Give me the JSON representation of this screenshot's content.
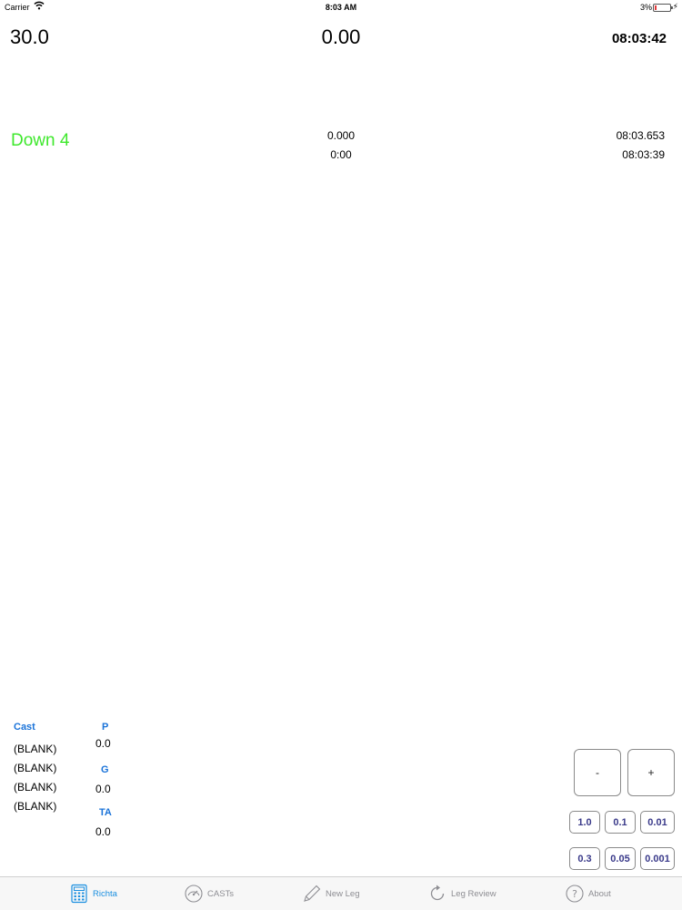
{
  "status_bar": {
    "carrier": "Carrier",
    "time": "8:03 AM",
    "battery_pct": "3%",
    "icons": [
      "wifi-icon",
      "battery-icon",
      "charging-bolt-icon"
    ]
  },
  "readout": {
    "left_value": "30.0",
    "center_value": "0.00",
    "right_time": "08:03:42",
    "status_text": "Down 4",
    "center_line1": "0.000",
    "center_line2": "0:00",
    "right_line1": "08:03.653",
    "right_line2": "08:03:39"
  },
  "info": {
    "cast_label": "Cast",
    "casts": [
      "(BLANK)",
      "(BLANK)",
      "(BLANK)",
      "(BLANK)"
    ],
    "p_label": "P",
    "p_value": "0.0",
    "g_label": "G",
    "g_value": "0.0",
    "ta_label": "TA",
    "ta_value": "0.0"
  },
  "controls": {
    "minus": "-",
    "plus": "+",
    "increments_row1": [
      "1.0",
      "0.1",
      "0.01"
    ],
    "increments_row2": [
      "0.3",
      "0.05",
      "0.001"
    ]
  },
  "tabs": [
    {
      "label": "Richta",
      "icon": "calculator-icon",
      "active": true
    },
    {
      "label": "CASTs",
      "icon": "speedometer-icon",
      "active": false
    },
    {
      "label": "New Leg",
      "icon": "pencil-icon",
      "active": false
    },
    {
      "label": "Leg Review",
      "icon": "refresh-icon",
      "active": false
    },
    {
      "label": "About",
      "icon": "question-icon",
      "active": false
    }
  ],
  "colors": {
    "accent": "#1a8fe0",
    "status_green": "#3ee82c",
    "label_blue": "#1a73d9"
  }
}
